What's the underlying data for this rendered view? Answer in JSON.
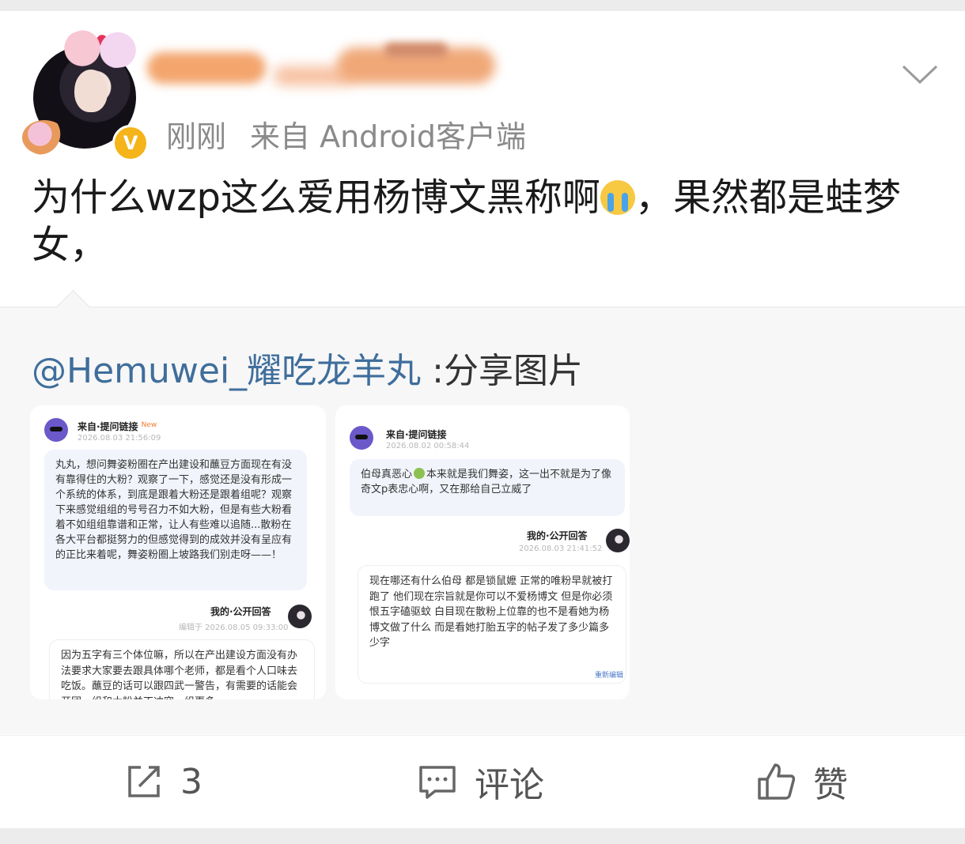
{
  "post": {
    "meta_time": "刚刚",
    "meta_source": "来自 Android客户端",
    "verified_badge": "V",
    "text_before_emoji": "为什么wzp这么爱用杨博文黑称啊",
    "text_after_emoji": "，果然都是蛙梦女，",
    "emoji": "crying-face"
  },
  "repost": {
    "author": "@Hemuwei_耀吃龙羊丸",
    "suffix": " :分享图片",
    "image1": {
      "question_title": "来自·提问链接",
      "new_tag": "New",
      "question_time": "2026.08.03 21:56:09",
      "question_text": "丸丸，想问舞姿粉圈在产出建设和蘸豆方面现在有没有靠得住的大粉？观察了一下，感觉还是没有形成一个系统的体系，到底是跟着大粉还是跟着组呢？观察下来感觉组组的号号召力不如大粉，但是有些大粉看着不如组组靠谱和正常，让人有些难以追随...散粉在各大平台都挺努力的但感觉得到的成效并没有呈应有的正比来着呢，舞姿粉圈上坡路我们别走呀——！",
      "answer_title": "我的·公开回答",
      "answer_time": "编辑于 2026.08.05 09:33:00",
      "answer_text": "因为五字有三个体位嘛，所以在产出建设方面没有办法要求大家要去跟具体哪个老师，都是看个人口味去吃饭。蘸豆的话可以跟四武一警告，有需要的话能会开团，组和大粉并不冲突，组更多"
    },
    "image2": {
      "question_title": "来自·提问链接",
      "question_time": "2026.08.02 00:58:44",
      "question_text_before": "伯母真恶心",
      "question_text_after": "本来就是我们舞姿，这一出不就是为了像奇文p表忠心啊，又在那给自己立威了",
      "answer_title": "我的·公开回答",
      "answer_time": "2026.08.03 21:41:52",
      "answer_text": "现在哪还有什么伯母 都是锁鼠嬷 正常的唯粉早就被打跑了 他们现在宗旨就是你可以不爱杨博文 但是你必须恨五字磕驱蚊 白目现在散粉上位靠的也不是看她为杨博文做了什么 而是看她打胎五字的帖子发了多少篇多少字",
      "edit_link": "重新编辑"
    }
  },
  "actions": {
    "repost_count": "3",
    "comment_label": "评论",
    "like_label": "赞"
  },
  "colors": {
    "link": "#3f6e9c",
    "badge": "#f4b41a",
    "repost_bg": "#f7f7f7"
  }
}
